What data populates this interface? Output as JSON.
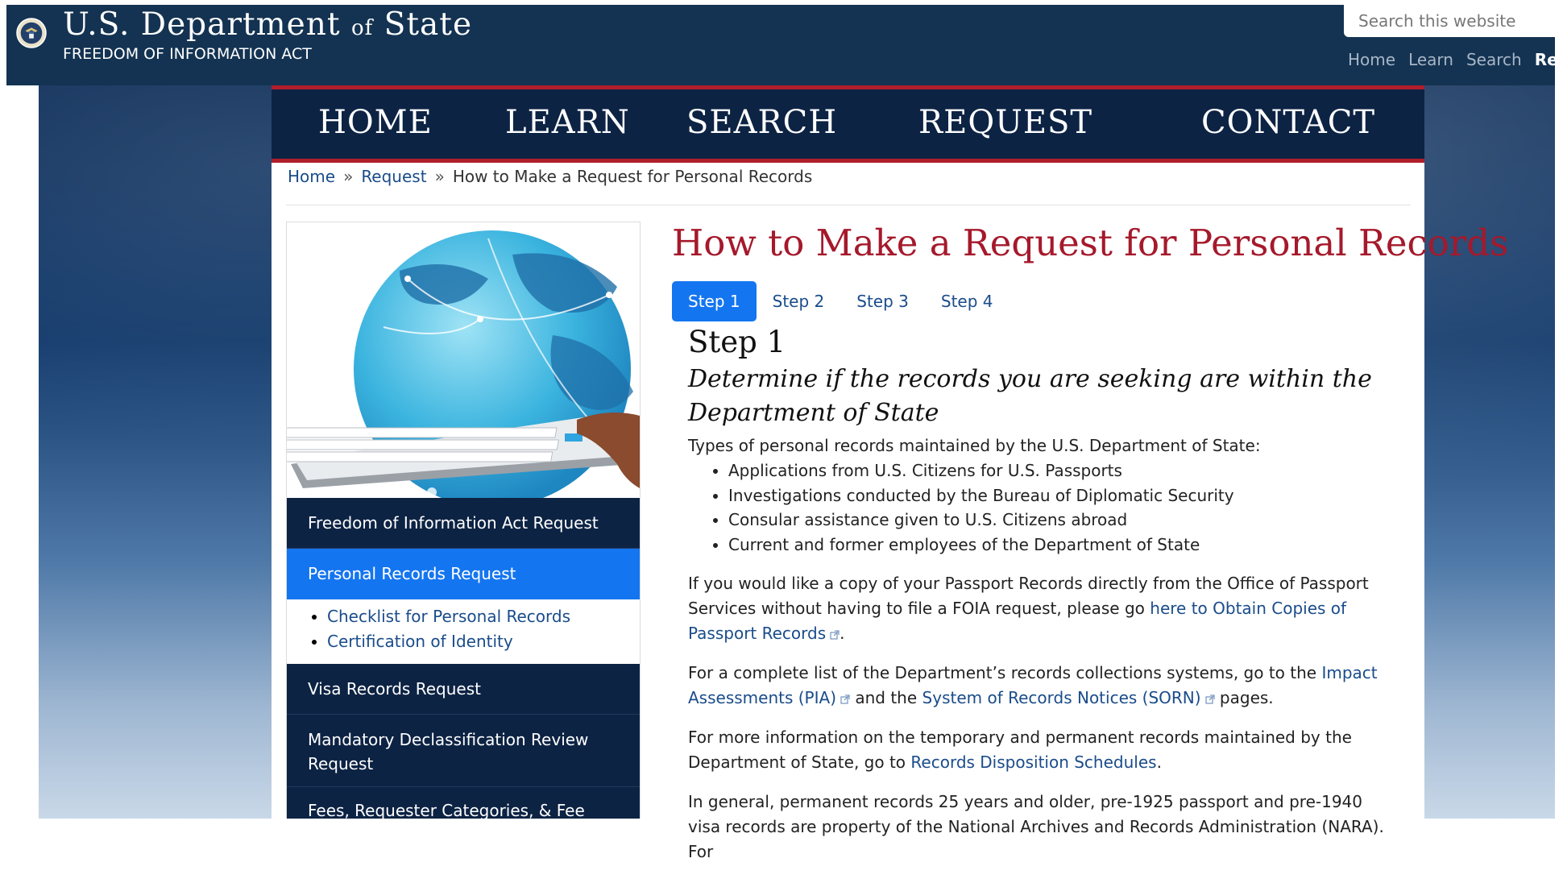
{
  "header": {
    "title_main": "U.S. Department",
    "title_of": "of",
    "title_end": "State",
    "subtitle": "FREEDOM OF INFORMATION ACT",
    "search_placeholder": "Search this website",
    "util_nav": [
      "Home",
      "Learn",
      "Search",
      "Re"
    ]
  },
  "main_nav": [
    "HOME",
    "LEARN",
    "SEARCH",
    "REQUEST",
    "CONTACT"
  ],
  "breadcrumb": {
    "items": [
      "Home",
      "Request"
    ],
    "separator": "»",
    "current": "How to Make a Request for Personal Records"
  },
  "sidebar": {
    "items": [
      "Freedom of Information Act Request",
      "Personal Records Request",
      "Visa Records Request",
      "Mandatory Declassification Review",
      "Request",
      "Fees, Requester Categories, & Fee"
    ],
    "sub_links": [
      "Checklist for Personal Records",
      "Certification of Identity"
    ]
  },
  "page_title": "How to Make a Request for Personal Records",
  "tabs": [
    "Step 1",
    "Step 2",
    "Step 3",
    "Step 4"
  ],
  "content": {
    "step_heading": "Step 1",
    "step_subheading": "Determine if the records you are seeking are within the Department of State",
    "intro": "Types of personal records maintained by the U.S. Department of State:",
    "record_types": [
      "Applications from U.S. Citizens for U.S. Passports",
      "Investigations conducted by the Bureau of Diplomatic Security",
      "Consular assistance given to U.S. Citizens abroad",
      "Current and former employees of the Department of State"
    ],
    "p1_text": "If you would like a copy of your Passport Records directly from the Office of Passport Services without having to file a FOIA request, please go ",
    "p1_link": "here to Obtain Copies of Passport Records",
    "p1_end": ".",
    "p2_text": "For a complete list of the Department’s records collections systems, go to the ",
    "p2_link1": "Impact Assessments (PIA)",
    "p2_mid": " and the ",
    "p2_link2": "System of Records Notices (SORN)",
    "p2_end": " pages.",
    "p3_text": "For more information on the temporary and permanent records maintained by the Department of State, go to ",
    "p3_link": "Records Disposition Schedules",
    "p3_end": ".",
    "p4_text": "In general, permanent records 25 years and older, pre-1925 passport and pre-1940 visa records are property of the National Archives and Records Administration (NARA). For"
  },
  "colors": {
    "header_bg": "#143352",
    "nav_bg": "#0d2344",
    "accent_red": "#b01e2b",
    "title_red": "#a5192b",
    "active_blue": "#1475f0",
    "link_blue": "#1a4c8a"
  }
}
